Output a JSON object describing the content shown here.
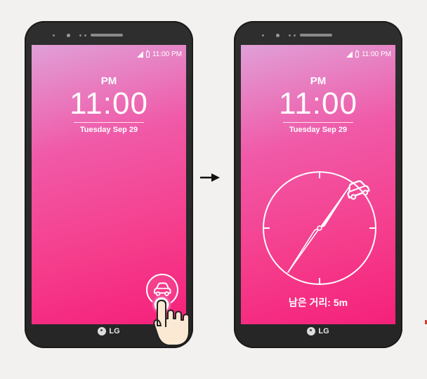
{
  "arrow_icon": "right-arrow-icon",
  "phones": [
    {
      "status_time": "11:00 PM",
      "ampm": "PM",
      "clock": "11:00",
      "date": "Tuesday Sep 29",
      "brand": "LG"
    },
    {
      "status_time": "11:00 PM",
      "ampm": "PM",
      "clock": "11:00",
      "date": "Tuesday Sep 29",
      "distance_label": "남은 거리: 5m",
      "brand": "LG"
    }
  ],
  "colors": {
    "screen_top": "#e0a0d8",
    "screen_bottom": "#f5207a",
    "frame": "#2b2b2b",
    "background": "#f2f1ef"
  }
}
